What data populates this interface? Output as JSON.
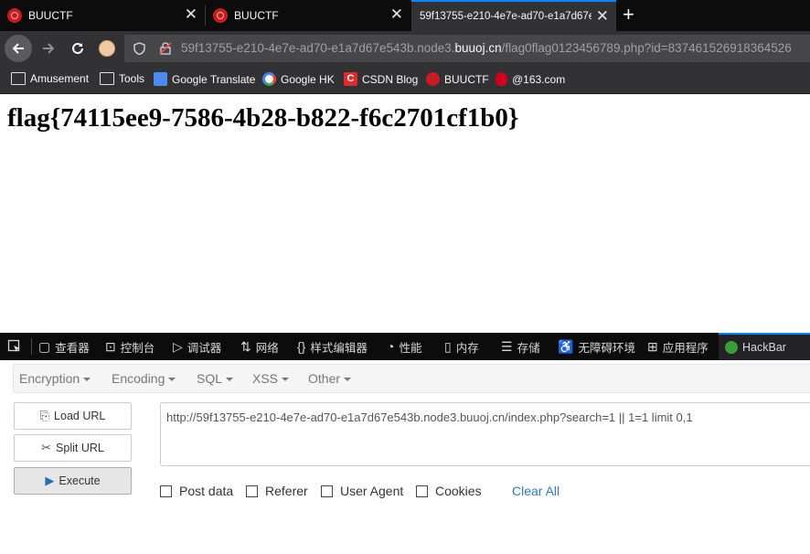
{
  "tabs": [
    {
      "title": "BUUCTF",
      "close": "✕"
    },
    {
      "title": "BUUCTF",
      "close": "✕"
    },
    {
      "title": "59f13755-e210-4e7e-ad70-e1a7d67e",
      "close": "✕"
    }
  ],
  "new_tab": "+",
  "address_bar": {
    "url_prefix": "59f13755-e210-4e7e-ad70-e1a7d67e543b.node3.",
    "url_host": "buuoj.cn",
    "url_suffix": "/flag0flag0123456789.php?id=837461526918364526"
  },
  "bookmarks": [
    {
      "label": "Amusement",
      "icon": "folder-icon"
    },
    {
      "label": "Tools",
      "icon": "folder-icon"
    },
    {
      "label": "Google Translate",
      "icon": "google-translate-icon"
    },
    {
      "label": "Google HK",
      "icon": "google-icon"
    },
    {
      "label": "CSDN Blog",
      "icon": "csdn-icon"
    },
    {
      "label": "BUUCTF",
      "icon": "buuctf-icon"
    },
    {
      "label": "@163.com",
      "icon": "netease-icon"
    }
  ],
  "page": {
    "flag": "flag{74115ee9-7586-4b28-b822-f6c2701cf1b0}"
  },
  "devtools": {
    "tabs": [
      {
        "label": "查看器",
        "icon": "inspector-icon"
      },
      {
        "label": "控制台",
        "icon": "console-icon"
      },
      {
        "label": "调试器",
        "icon": "debugger-icon"
      },
      {
        "label": "网络",
        "icon": "network-icon"
      },
      {
        "label": "样式编辑器",
        "icon": "style-editor-icon"
      },
      {
        "label": "性能",
        "icon": "performance-icon"
      },
      {
        "label": "内存",
        "icon": "memory-icon"
      },
      {
        "label": "存储",
        "icon": "storage-icon"
      },
      {
        "label": "无障碍环境",
        "icon": "accessibility-icon"
      },
      {
        "label": "应用程序",
        "icon": "application-icon"
      },
      {
        "label": "HackBar",
        "icon": "hackbar-icon"
      }
    ]
  },
  "hackbar": {
    "menu": [
      "Encryption",
      "Encoding",
      "SQL",
      "XSS",
      "Other"
    ],
    "buttons": {
      "load_url": "Load URL",
      "split_url": "Split URL",
      "execute": "Execute"
    },
    "url_value": "http://59f13755-e210-4e7e-ad70-e1a7d67e543b.node3.buuoj.cn/index.php?search=1 || 1=1 limit 0,1",
    "checks": [
      "Post data",
      "Referer",
      "User Agent",
      "Cookies"
    ],
    "clear_all": "Clear All"
  },
  "colors": {
    "accent": "#0a84ff",
    "chrome_dark": "#0c0c0d",
    "toolbar": "#323234",
    "link": "#337ab7"
  }
}
